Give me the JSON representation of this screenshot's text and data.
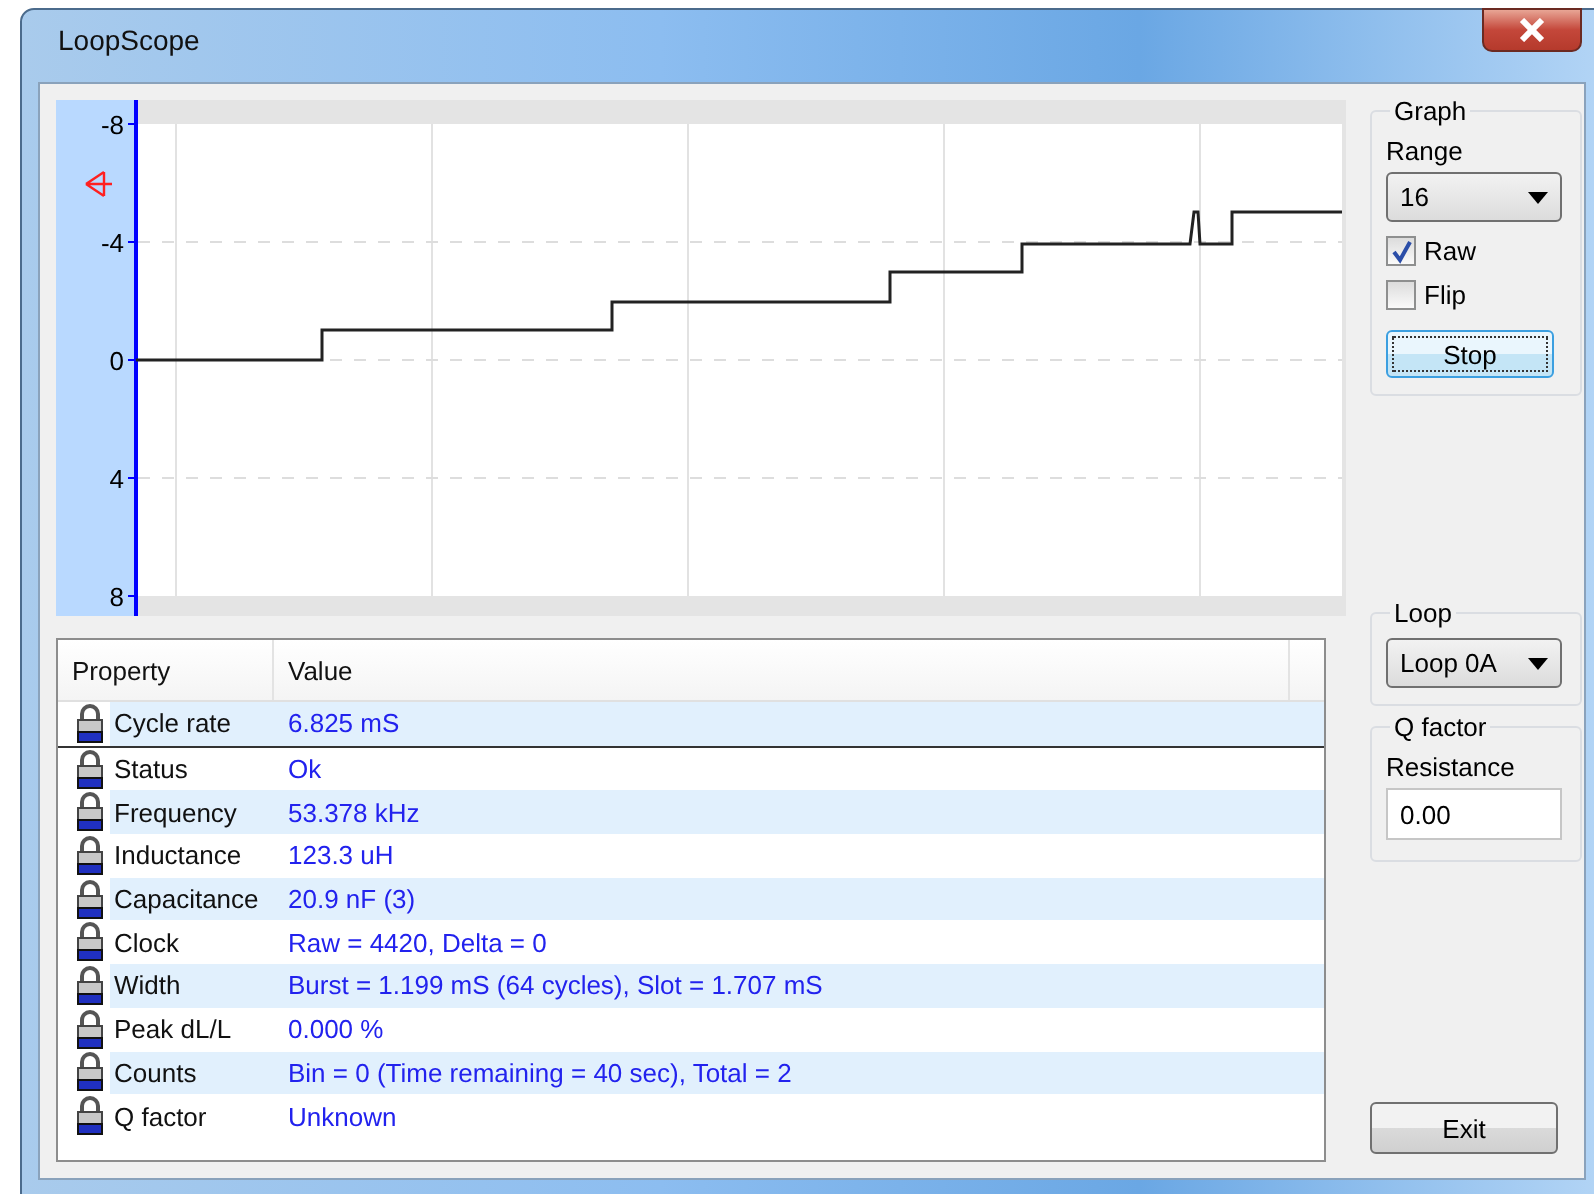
{
  "window": {
    "title": "LoopScope"
  },
  "graph": {
    "y_labels": [
      "-8",
      "-4",
      "0",
      "4",
      "8"
    ]
  },
  "graph_group": {
    "title": "Graph",
    "range_label": "Range",
    "range_value": "16",
    "checkboxes": [
      {
        "label": "Raw",
        "checked": true
      },
      {
        "label": "Flip",
        "checked": false
      }
    ],
    "button": {
      "label": "Stop",
      "focused": true
    }
  },
  "table": {
    "columns": [
      "Property",
      "Value"
    ],
    "rows": [
      {
        "property": "Cycle rate",
        "value": "6.825 mS",
        "selected": true
      },
      {
        "property": "Status",
        "value": "Ok",
        "selected": false
      },
      {
        "property": "Frequency",
        "value": "53.378 kHz",
        "selected": false
      },
      {
        "property": "Inductance",
        "value": "123.3 uH",
        "selected": false
      },
      {
        "property": "Capacitance",
        "value": "20.9 nF (3)",
        "selected": false
      },
      {
        "property": "Clock",
        "value": "Raw = 4420, Delta = 0",
        "selected": false
      },
      {
        "property": "Width",
        "value": "Burst = 1.199 mS (64 cycles), Slot = 1.707 mS",
        "selected": false
      },
      {
        "property": "Peak dL/L",
        "value": "0.000 %",
        "selected": false
      },
      {
        "property": "Counts",
        "value": "Bin = 0 (Time remaining = 40 sec), Total = 2",
        "selected": false
      },
      {
        "property": "Q factor",
        "value": "Unknown",
        "selected": false
      }
    ]
  },
  "loop_group": {
    "title": "Loop",
    "value": "Loop 0A"
  },
  "qfactor_group": {
    "title": "Q factor",
    "label": "Resistance",
    "value": "0.00"
  },
  "exit_button": "Exit"
}
